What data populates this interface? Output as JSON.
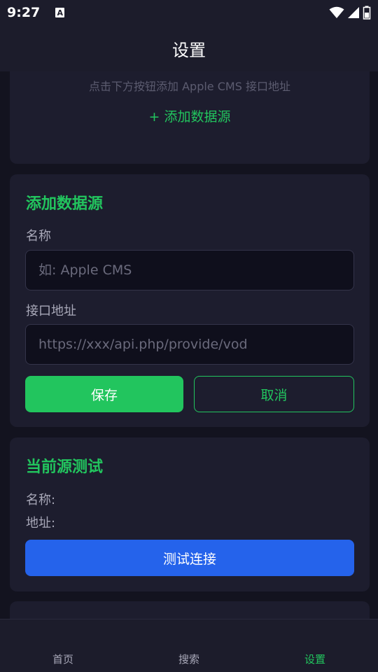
{
  "status_bar": {
    "time": "9:27",
    "notification_icon": "A"
  },
  "app_bar": {
    "title": "设置"
  },
  "sources_card": {
    "hint": "点击下方按钮添加 Apple CMS 接口地址",
    "add_button_label": "+ 添加数据源"
  },
  "add_form": {
    "title": "添加数据源",
    "name_label": "名称",
    "name_placeholder": "如: Apple CMS",
    "name_value": "",
    "url_label": "接口地址",
    "url_placeholder": "https://xxx/api.php/provide/vod",
    "url_value": "",
    "save_label": "保存",
    "cancel_label": "取消"
  },
  "current_test": {
    "title": "当前源测试",
    "name_line": "名称:",
    "url_line": "地址:",
    "test_button_label": "测试连接"
  },
  "bottom_nav": {
    "items": [
      {
        "label": "首页",
        "active": false
      },
      {
        "label": "搜索",
        "active": false
      },
      {
        "label": "设置",
        "active": true
      }
    ]
  },
  "colors": {
    "accent_green": "#22c55e",
    "accent_blue": "#2563eb",
    "background": "#13131f",
    "card": "#1d1d2e"
  }
}
